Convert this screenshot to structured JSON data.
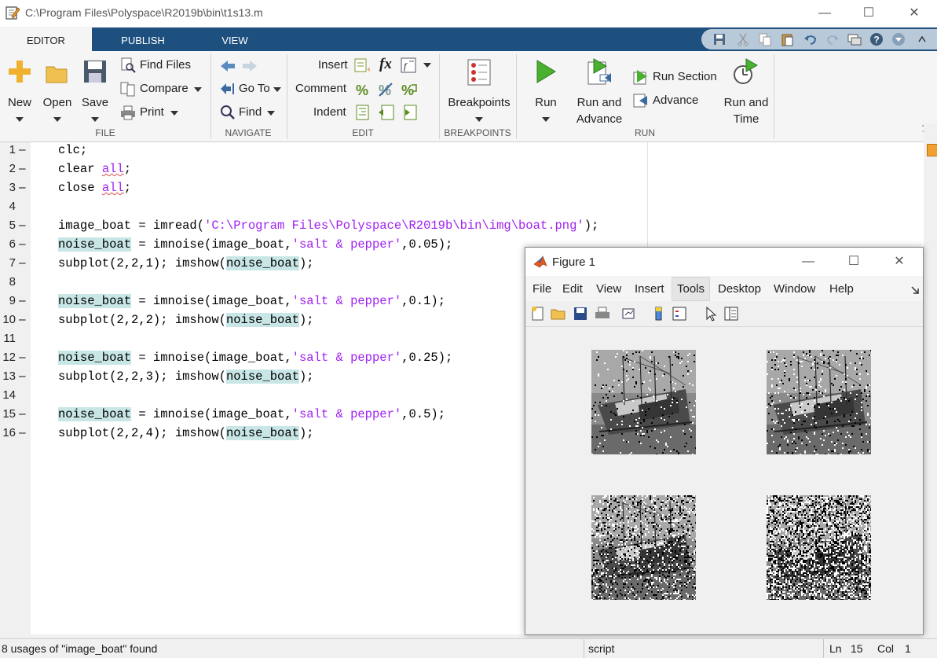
{
  "window": {
    "title": "C:\\Program Files\\Polyspace\\R2019b\\bin\\t1s13.m",
    "minimize": "—",
    "maximize": "☐",
    "close": "✕"
  },
  "tabs": [
    {
      "label": "EDITOR",
      "active": true
    },
    {
      "label": "PUBLISH",
      "active": false
    },
    {
      "label": "VIEW",
      "active": false
    }
  ],
  "ribbon": {
    "file": {
      "section": "FILE",
      "new": "New",
      "open": "Open",
      "save": "Save",
      "find_files": "Find Files",
      "compare": "Compare",
      "print": "Print"
    },
    "navigate": {
      "section": "NAVIGATE",
      "go_to": "Go To",
      "find": "Find"
    },
    "edit": {
      "section": "EDIT",
      "insert": "Insert",
      "comment": "Comment",
      "indent": "Indent",
      "fx": "fx"
    },
    "breakpoints": {
      "section": "BREAKPOINTS",
      "breakpoints": "Breakpoints"
    },
    "run": {
      "section": "RUN",
      "run": "Run",
      "run_and_advance_1": "Run and",
      "run_and_advance_2": "Advance",
      "run_section": "Run Section",
      "advance": "Advance",
      "run_and_time_1": "Run and",
      "run_and_time_2": "Time"
    }
  },
  "code_lines": [
    {
      "n": "1",
      "dash": "–",
      "text": "clc;"
    },
    {
      "n": "2",
      "dash": "–",
      "a": "clear ",
      "b": "all",
      "c": ";"
    },
    {
      "n": "3",
      "dash": "–",
      "a": "close ",
      "b": "all",
      "c": ";"
    },
    {
      "n": "4",
      "dash": "",
      "text": ""
    },
    {
      "n": "5",
      "dash": "–",
      "a": "image_boat = imread(",
      "b": "'C:\\Program Files\\Polyspace\\R2019b\\bin\\img\\boat.png'",
      "c": ");"
    },
    {
      "n": "6",
      "dash": "–",
      "hl": "noise_boat",
      "a": " = imnoise(image_boat,",
      "b": "'salt & pepper'",
      "c": ",0.05);"
    },
    {
      "n": "7",
      "dash": "–",
      "a": "subplot(2,2,1); imshow(",
      "hl2": "noise_boat",
      "c": ");"
    },
    {
      "n": "8",
      "dash": "",
      "text": ""
    },
    {
      "n": "9",
      "dash": "–",
      "hl": "noise_boat",
      "a": " = imnoise(image_boat,",
      "b": "'salt & pepper'",
      "c": ",0.1);"
    },
    {
      "n": "10",
      "dash": "–",
      "a": "subplot(2,2,2); imshow(",
      "hl2": "noise_boat",
      "c": ");"
    },
    {
      "n": "11",
      "dash": "",
      "text": ""
    },
    {
      "n": "12",
      "dash": "–",
      "hl": "noise_boat",
      "a": " = imnoise(image_boat,",
      "b": "'salt & pepper'",
      "c": ",0.25);"
    },
    {
      "n": "13",
      "dash": "–",
      "a": "subplot(2,2,3); imshow(",
      "hl2": "noise_boat",
      "c": ");"
    },
    {
      "n": "14",
      "dash": "",
      "text": ""
    },
    {
      "n": "15",
      "dash": "–",
      "hl": "noise_boat",
      "a": " = imnoise(image_boat,",
      "b": "'salt & pepper'",
      "c": ",0.5);"
    },
    {
      "n": "16",
      "dash": "–",
      "a": "subplot(2,2,4); imshow(",
      "hl2": "noise_boat",
      "c": ");"
    }
  ],
  "figure": {
    "title": "Figure 1",
    "menu": [
      "File",
      "Edit",
      "View",
      "Insert",
      "Tools",
      "Desktop",
      "Window",
      "Help"
    ],
    "selected_menu": "Tools",
    "noise_densities": [
      0.05,
      0.1,
      0.25,
      0.5
    ]
  },
  "status": {
    "message": "8 usages of \"image_boat\" found",
    "mode": "script",
    "ln_label": "Ln",
    "ln": "15",
    "col_label": "Col",
    "col": "1"
  },
  "colors": {
    "tab_strip": "#1d4f7f",
    "string": "#a020f0",
    "highlight": "#c8e6e6"
  }
}
